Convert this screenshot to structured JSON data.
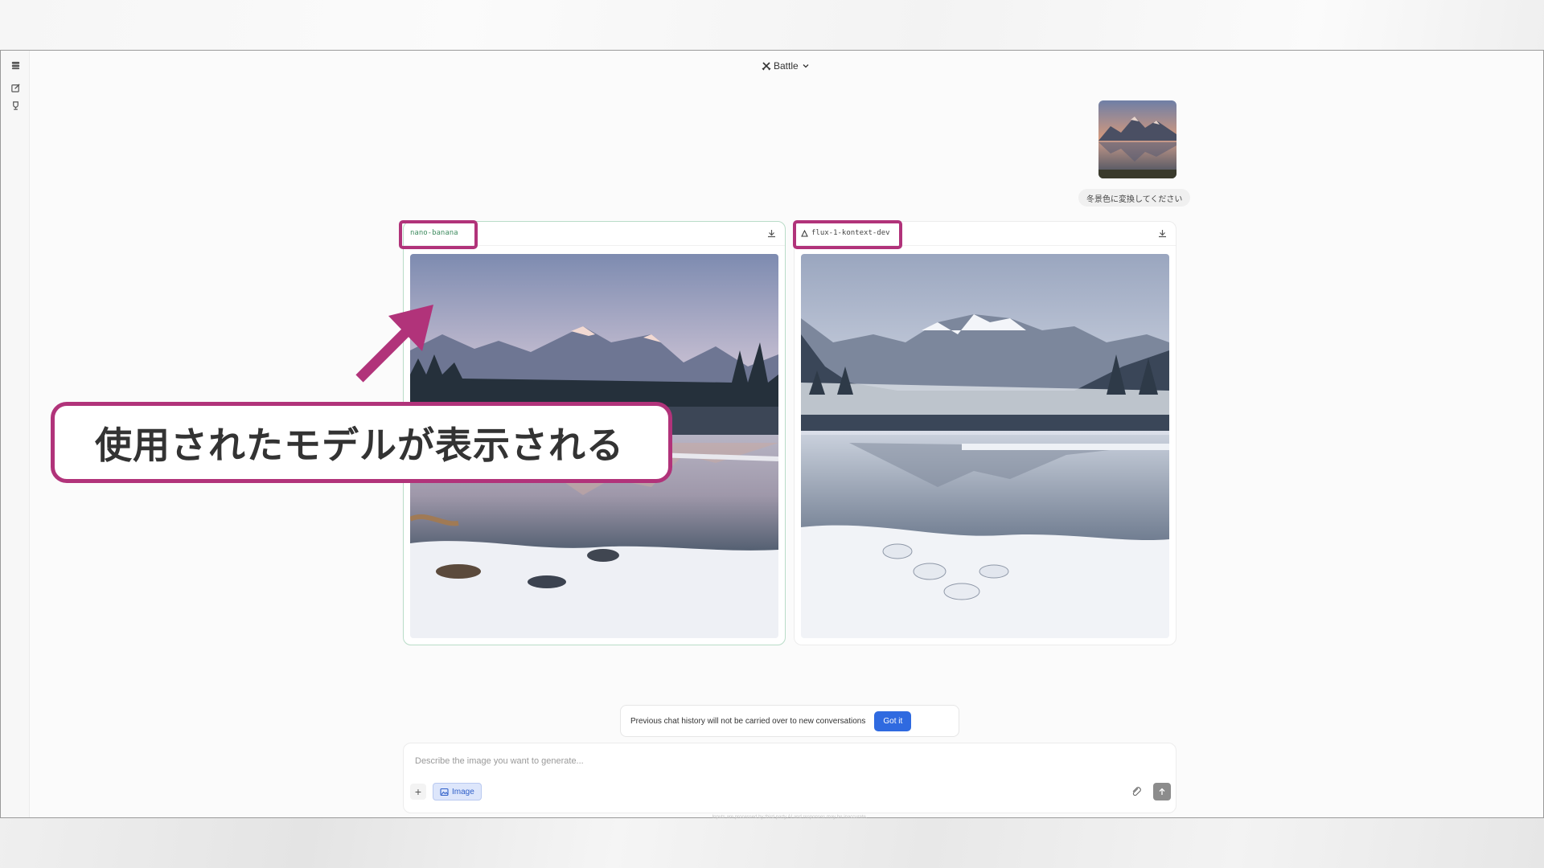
{
  "header": {
    "title": "Battle"
  },
  "sidebar": {
    "items": [
      {
        "icon": "stack-icon"
      },
      {
        "icon": "new-chat-icon"
      },
      {
        "icon": "trophy-icon"
      }
    ]
  },
  "user_message": {
    "text": "冬景色に変換してください",
    "attachment_icon": "mountain-lake-photo"
  },
  "results": [
    {
      "model": "nano-banana",
      "selected": true
    },
    {
      "model": "flux-1-kontext-dev",
      "selected": false
    }
  ],
  "annotation": {
    "text": "使用されたモデルが表示される",
    "color": "#b1337a"
  },
  "toast": {
    "message": "Previous chat history will not be carried over to new conversations",
    "button": "Got it"
  },
  "composer": {
    "placeholder": "Describe the image you want to generate...",
    "mode_label": "Image",
    "disclaimer": "Inputs are processed by third-party AI and responses may be inaccurate."
  },
  "colors": {
    "accent": "#2f6ae0",
    "selected_border": "#b9dcc8",
    "highlight": "#b1337a"
  }
}
